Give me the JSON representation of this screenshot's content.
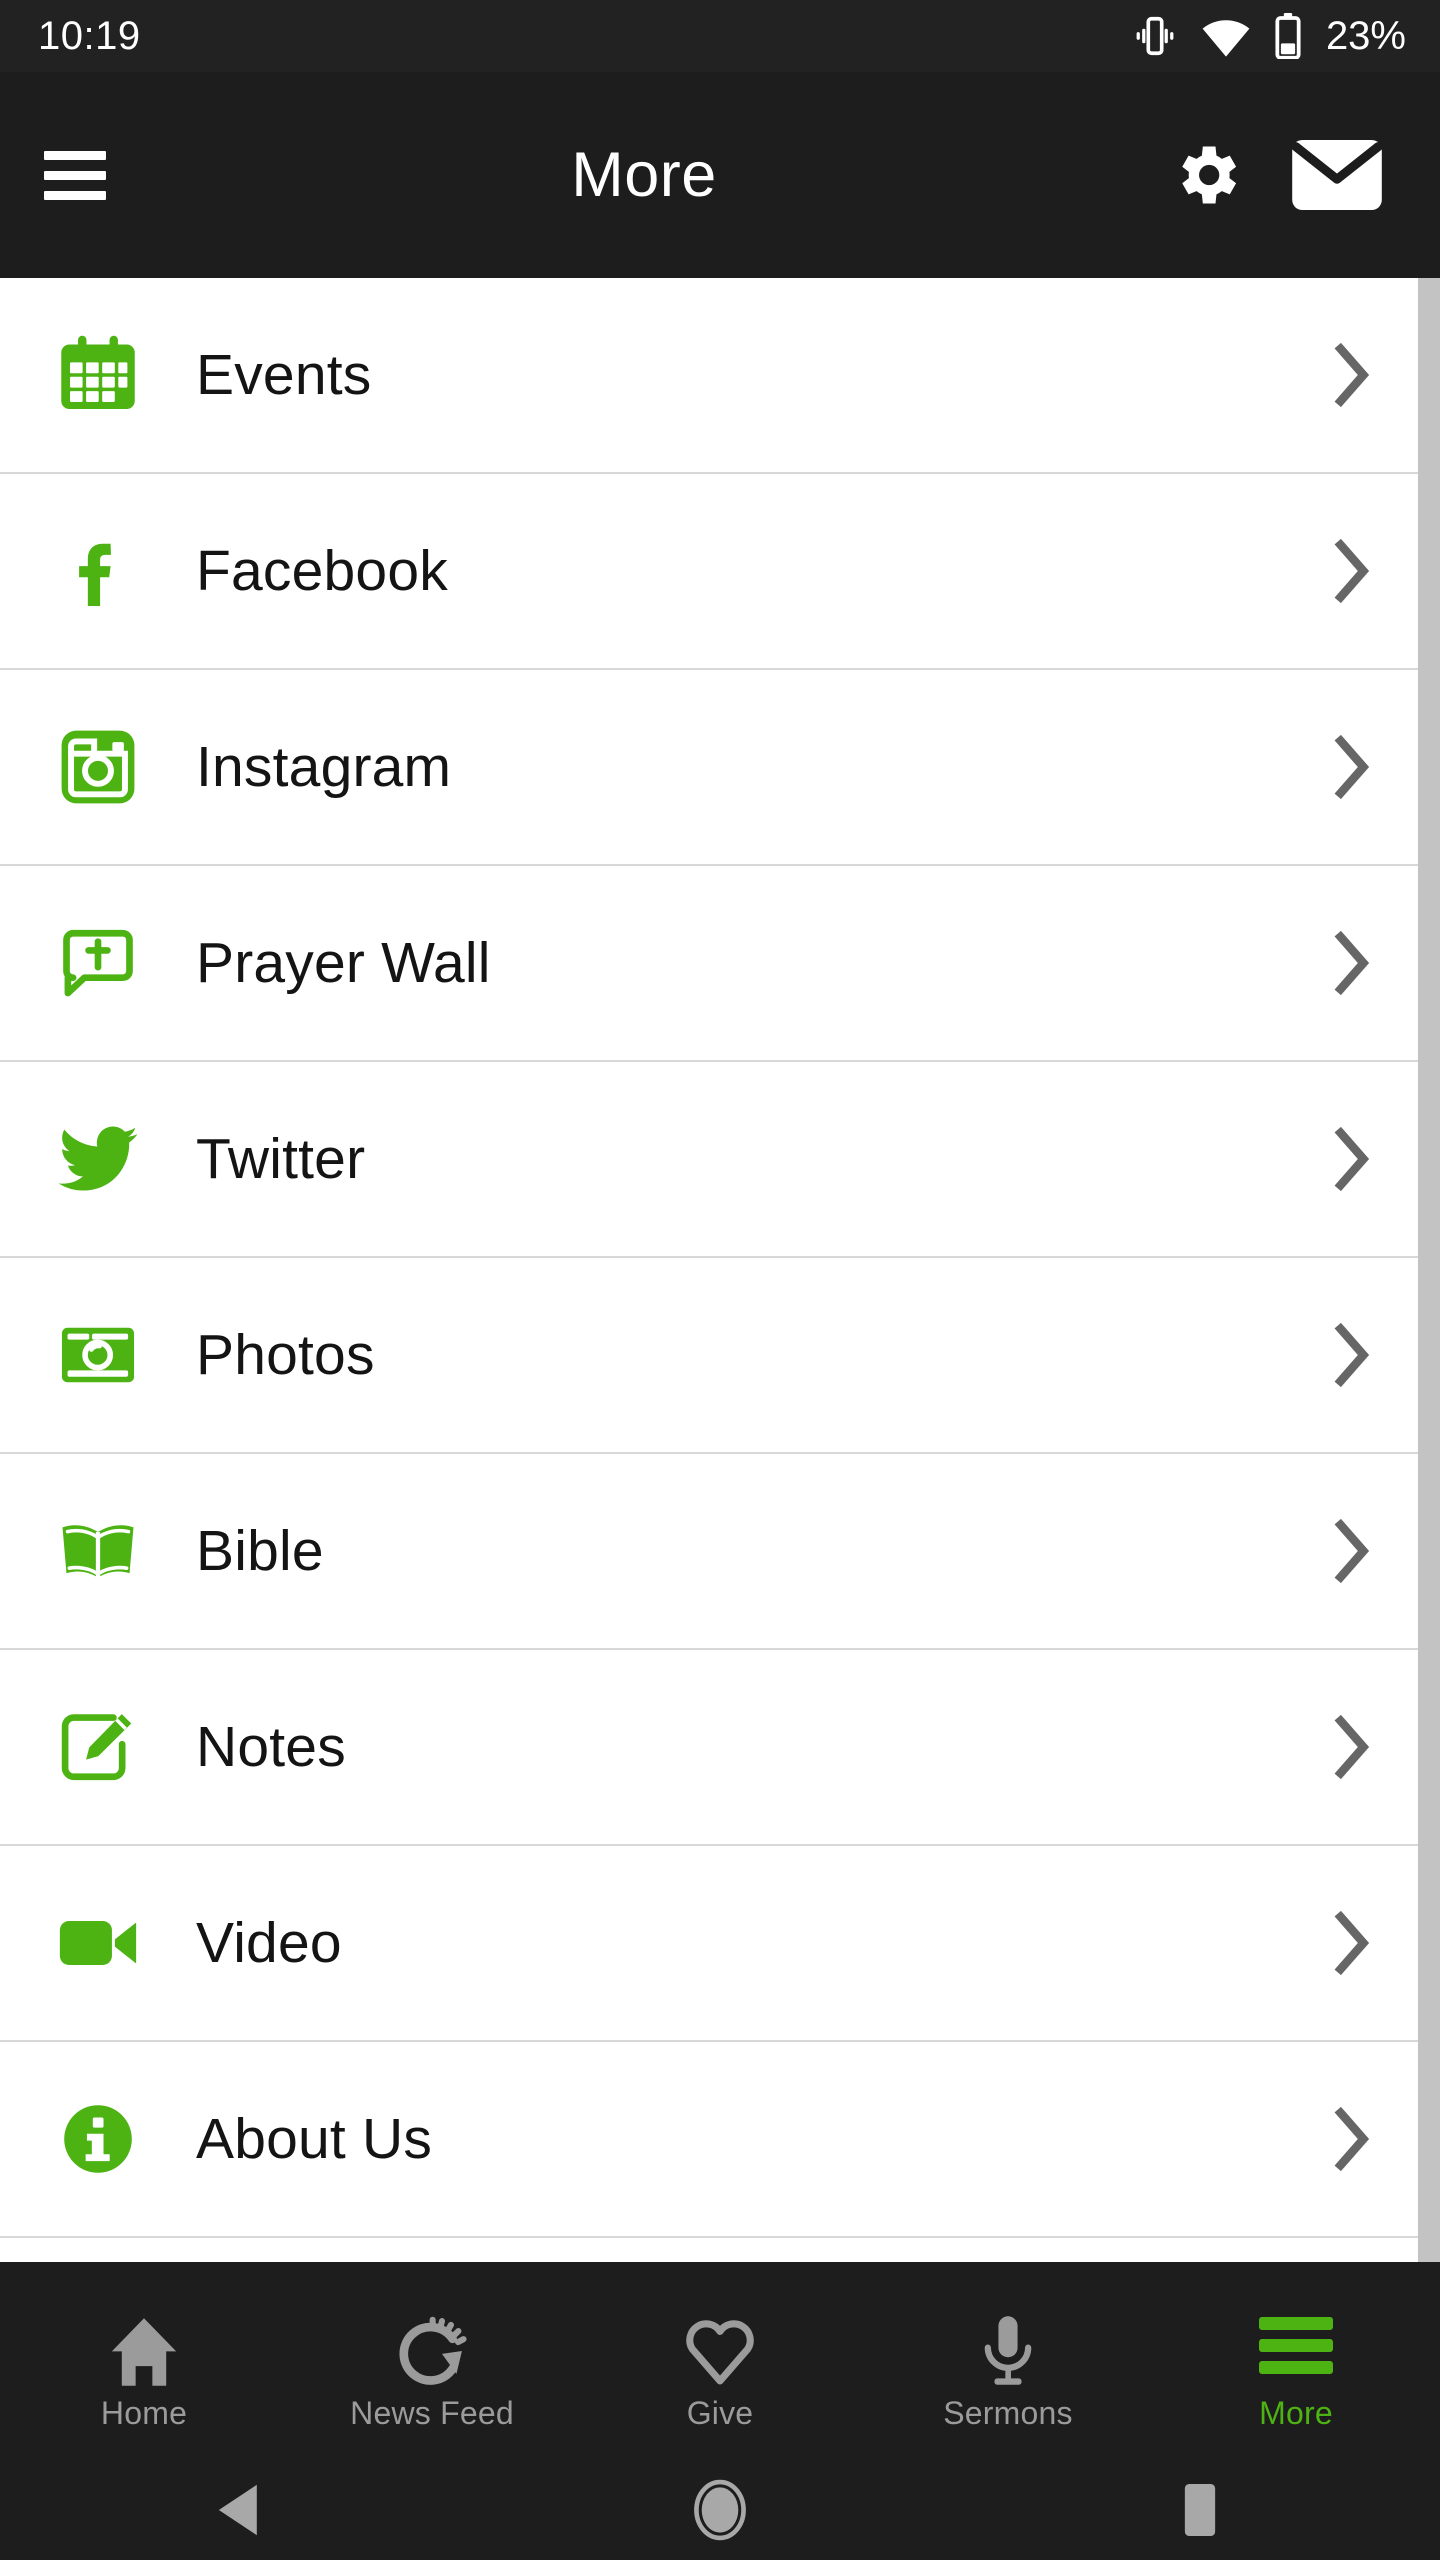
{
  "status_bar": {
    "time": "10:19",
    "battery_percent": "23%",
    "icons": [
      "vibrate-icon",
      "wifi-icon",
      "battery-icon"
    ],
    "background_color": "#222222",
    "text_color": "#ffffff"
  },
  "header": {
    "title": "More",
    "menu_icon": "hamburger-menu-icon",
    "actions": [
      {
        "name": "settings",
        "icon": "gear-icon"
      },
      {
        "name": "messages",
        "icon": "envelope-icon"
      }
    ],
    "background_color": "#1d1d1d"
  },
  "theme": {
    "accent_green": "#4cb313",
    "list_background": "#ffffff",
    "divider_color": "#d8d8d8",
    "chevron_color": "#666666",
    "scrollbar_color": "#c3c3c3",
    "inactive_tab_color": "#9b9b9b"
  },
  "list": {
    "items": [
      {
        "label": "Events",
        "icon": "calendar-icon",
        "chevron": "chevron-right-icon"
      },
      {
        "label": "Facebook",
        "icon": "facebook-icon",
        "chevron": "chevron-right-icon"
      },
      {
        "label": "Instagram",
        "icon": "instagram-icon",
        "chevron": "chevron-right-icon"
      },
      {
        "label": "Prayer Wall",
        "icon": "prayer-bubble-icon",
        "chevron": "chevron-right-icon"
      },
      {
        "label": "Twitter",
        "icon": "twitter-bird-icon",
        "chevron": "chevron-right-icon"
      },
      {
        "label": "Photos",
        "icon": "camera-icon",
        "chevron": "chevron-right-icon"
      },
      {
        "label": "Bible",
        "icon": "open-book-icon",
        "chevron": "chevron-right-icon"
      },
      {
        "label": "Notes",
        "icon": "edit-pencil-icon",
        "chevron": "chevron-right-icon"
      },
      {
        "label": "Video",
        "icon": "video-camera-icon",
        "chevron": "chevron-right-icon"
      },
      {
        "label": "About Us",
        "icon": "info-circle-icon",
        "chevron": "chevron-right-icon"
      }
    ]
  },
  "tab_bar": {
    "items": [
      {
        "label": "Home",
        "icon": "house-icon",
        "active": false
      },
      {
        "label": "News Feed",
        "icon": "refresh-gauge-icon",
        "active": false
      },
      {
        "label": "Give",
        "icon": "heart-icon",
        "active": false
      },
      {
        "label": "Sermons",
        "icon": "microphone-icon",
        "active": false
      },
      {
        "label": "More",
        "icon": "hamburger-icon",
        "active": true
      }
    ]
  },
  "android_nav": {
    "buttons": [
      {
        "name": "back",
        "icon": "back-triangle-icon"
      },
      {
        "name": "home",
        "icon": "home-circle-icon"
      },
      {
        "name": "recents",
        "icon": "recents-square-icon"
      }
    ]
  }
}
